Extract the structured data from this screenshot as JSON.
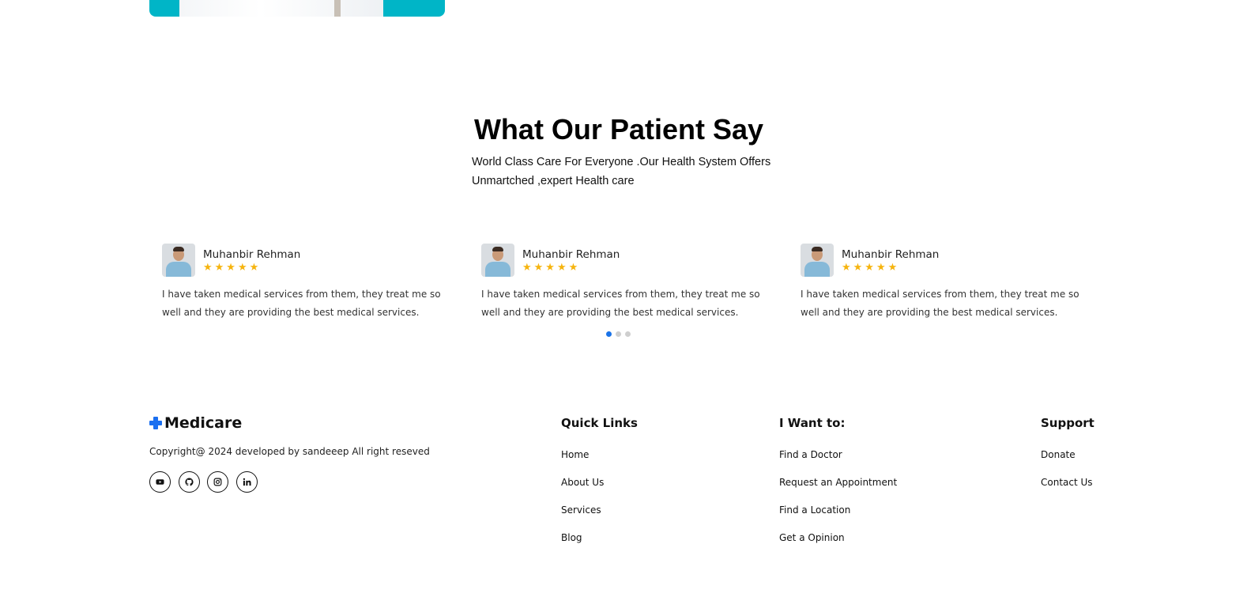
{
  "section": {
    "title": "What Our Patient Say",
    "subtitle_line1": "World Class Care For Everyone .Our Health System Offers",
    "subtitle_line2": "Unmartched ,expert Health care"
  },
  "testimonials": [
    {
      "name": "Muhanbir Rehman",
      "stars": "★★★★★",
      "rating": 5,
      "text": "I have taken medical services from them, they treat me so well and they are providing the best medical services."
    },
    {
      "name": "Muhanbir Rehman",
      "stars": "★★★★★",
      "rating": 5,
      "text": "I have taken medical services from them, they treat me so well and they are providing the best medical services."
    },
    {
      "name": "Muhanbir Rehman",
      "stars": "★★★★★",
      "rating": 5,
      "text": "I have taken medical services from them, they treat me so well and they are providing the best medical services."
    }
  ],
  "carousel": {
    "pages": 3,
    "active": 1
  },
  "footer": {
    "brand": "Medicare",
    "copyright": "Copyright@ 2024 developed by sandeeep All right reseved",
    "socials": [
      "youtube-icon",
      "github-icon",
      "instagram-icon",
      "linkedin-icon"
    ],
    "quick_links": {
      "title": "Quick Links",
      "items": [
        "Home",
        "About Us",
        "Services",
        "Blog"
      ]
    },
    "i_want_to": {
      "title": "I Want to:",
      "items": [
        "Find a Doctor",
        "Request an Appointment",
        "Find a Location",
        "Get a Opinion"
      ]
    },
    "support": {
      "title": "Support",
      "items": [
        "Donate",
        "Contact Us"
      ]
    }
  },
  "colors": {
    "accent": "#1a6ff0",
    "star": "#f6b40e",
    "banner": "#00b5c7",
    "dot_active": "#1a73e8"
  }
}
